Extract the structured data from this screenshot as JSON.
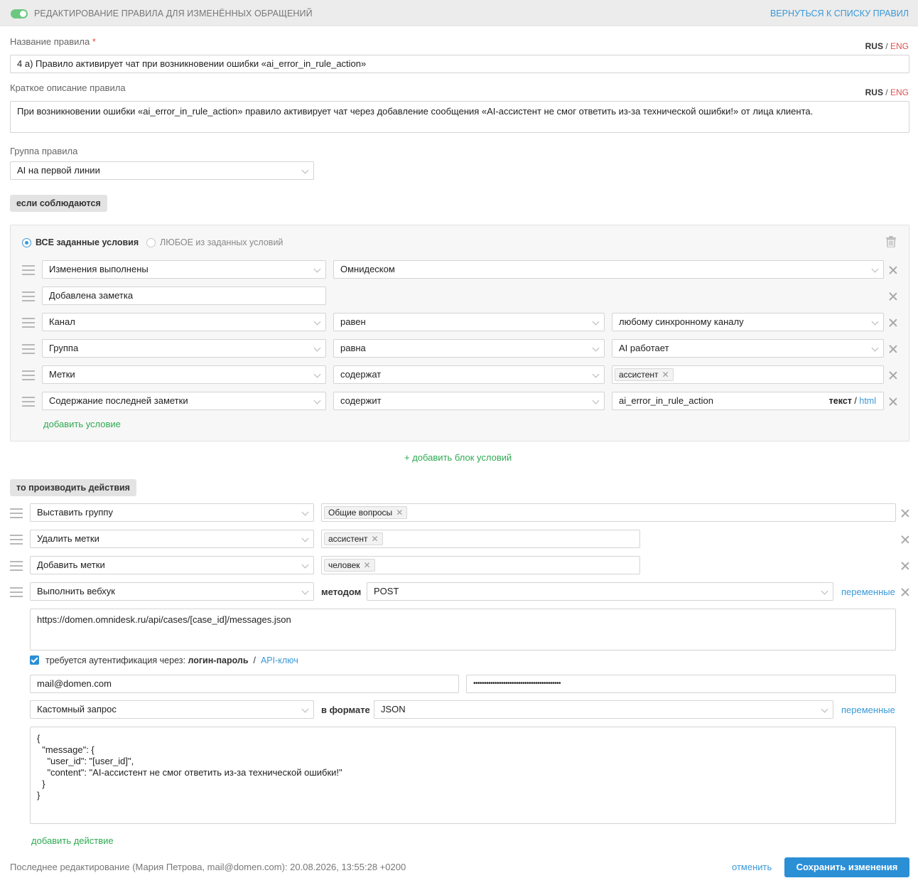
{
  "header": {
    "title": "РЕДАКТИРОВАНИЕ ПРАВИЛА ДЛЯ ИЗМЕНЁННЫХ ОБРАЩЕНИЙ",
    "back_link": "ВЕРНУТЬСЯ К СПИСКУ ПРАВИЛ",
    "toggle_state": "on"
  },
  "lang": {
    "rus": "RUS",
    "sep": "/",
    "eng": "ENG"
  },
  "rule_name": {
    "label": "Название правила",
    "required_mark": "*",
    "value": "4 а) Правило активирует чат при возникновении ошибки «ai_error_in_rule_action»"
  },
  "rule_desc": {
    "label": "Краткое описание правила",
    "value": "При возникновении ошибки «ai_error_in_rule_action» правило активирует чат через добавление сообщения «AI-ассистент не смог ответить из-за технической ошибки!» от лица клиента."
  },
  "rule_group": {
    "label": "Группа правила",
    "value": "AI на первой линии"
  },
  "conditions": {
    "section_label": "если соблюдаются",
    "mode_all": "ВСЕ заданные условия",
    "mode_any": "ЛЮБОЕ из заданных условий",
    "rows": [
      {
        "field": "Изменения выполнены",
        "op": "Омнидеском"
      },
      {
        "field": "Добавлена заметка"
      },
      {
        "field": "Канал",
        "op": "равен",
        "value": "любому синхронному каналу"
      },
      {
        "field": "Группа",
        "op": "равна",
        "value": "AI работает"
      },
      {
        "field": "Метки",
        "op": "содержат",
        "tag": "ассистент"
      },
      {
        "field": "Содержание последней заметки",
        "op": "содержит",
        "value": "ai_error_in_rule_action",
        "fmt_text": "текст",
        "fmt_sep": "/",
        "fmt_html": "html"
      }
    ],
    "add_condition": "добавить условие",
    "add_block": "+ добавить блок условий"
  },
  "actions": {
    "section_label": "то производить действия",
    "rows": [
      {
        "action": "Выставить группу",
        "tag": "Общие вопросы"
      },
      {
        "action": "Удалить метки",
        "tag": "ассистент"
      },
      {
        "action": "Добавить метки",
        "tag": "человек"
      },
      {
        "action": "Выполнить вебхук",
        "method_label": "методом",
        "method": "POST",
        "vars_link": "переменные"
      }
    ],
    "webhook": {
      "url": "https://domen.omnidesk.ru/api/cases/[case_id]/messages.json",
      "auth_label": "требуется аутентификация через:",
      "auth_login": "логин-пароль",
      "auth_sep": "/",
      "auth_api": "API-ключ",
      "login": "mail@domen.com",
      "password": "•••••••••••••••••••••••••••••••••••••••••",
      "request_type": "Кастомный запрос",
      "format_label": "в формате",
      "format": "JSON",
      "vars_link": "переменные",
      "body": "{\n  \"message\": {\n    \"user_id\": \"[user_id]\",\n    \"content\": \"AI-ассистент не смог ответить из-за технической ошибки!\"\n  }\n}"
    },
    "add_action": "добавить действие"
  },
  "footer": {
    "last_edit": "Последнее редактирование (Мария Петрова, mail@domen.com): 20.08.2026, 13:55:28 +0200",
    "cancel": "отменить",
    "save": "Сохранить изменения"
  },
  "colors": {
    "accent": "#2b8fd6",
    "link": "#3a98d8",
    "green": "#2eaa52",
    "toggle": "#6cc87e",
    "required": "#e05050"
  }
}
